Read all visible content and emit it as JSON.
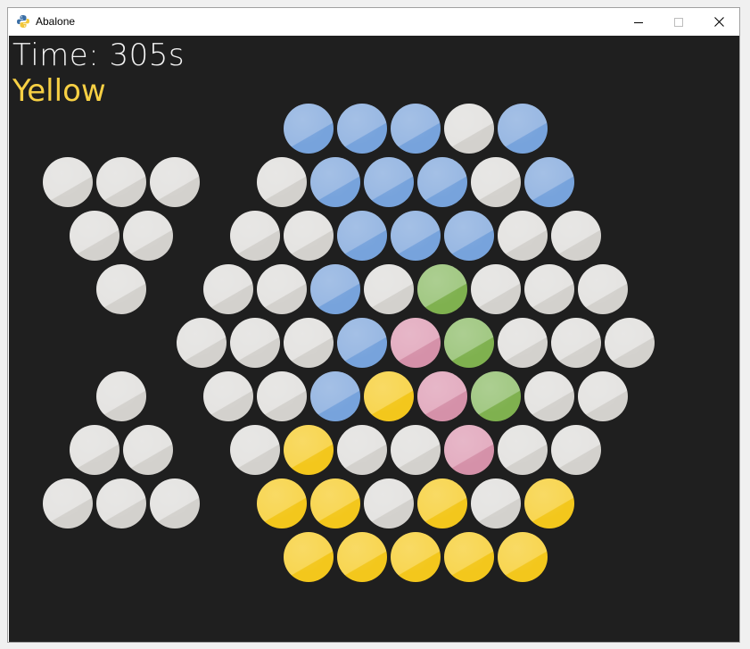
{
  "window": {
    "title": "Abalone",
    "icon": "python-snake-icon",
    "controls": [
      "minimize",
      "maximize",
      "close"
    ]
  },
  "hud": {
    "timer_text": "Time: 305s",
    "current_player": "Yellow",
    "current_player_color": "#f7d044",
    "text_color": "#f2f2f2"
  },
  "colors": {
    "background": "#1f1f1f",
    "empty": {
      "light": "#e5e4e2",
      "dark": "#d3d1cd"
    },
    "blue": {
      "light": "#9ab9e3",
      "dark": "#77a3dc"
    },
    "yellow": {
      "light": "#f8d653",
      "dark": "#f3c71c"
    },
    "pink": {
      "light": "#e4afc2",
      "dark": "#d591a9"
    },
    "green": {
      "light": "#a3c985",
      "dark": "#7fb14f"
    }
  },
  "board": {
    "rows": [
      [
        "blue",
        "blue",
        "blue",
        "empty",
        "blue"
      ],
      [
        "empty",
        "blue",
        "blue",
        "blue",
        "empty",
        "blue"
      ],
      [
        "empty",
        "empty",
        "blue",
        "blue",
        "blue",
        "empty",
        "empty"
      ],
      [
        "empty",
        "empty",
        "blue",
        "empty",
        "green",
        "empty",
        "empty",
        "empty"
      ],
      [
        "empty",
        "empty",
        "empty",
        "blue",
        "pink",
        "green",
        "empty",
        "empty",
        "empty"
      ],
      [
        "empty",
        "empty",
        "blue",
        "yellow",
        "pink",
        "green",
        "empty",
        "empty"
      ],
      [
        "empty",
        "yellow",
        "empty",
        "empty",
        "pink",
        "empty",
        "empty"
      ],
      [
        "yellow",
        "yellow",
        "empty",
        "yellow",
        "empty",
        "yellow"
      ],
      [
        "yellow",
        "yellow",
        "yellow",
        "yellow",
        "yellow"
      ]
    ]
  },
  "captured": {
    "top_tray": [
      "empty",
      "empty",
      "empty",
      "empty",
      "empty",
      "empty"
    ],
    "bottom_tray": [
      "empty",
      "empty",
      "empty",
      "empty",
      "empty",
      "empty"
    ]
  }
}
